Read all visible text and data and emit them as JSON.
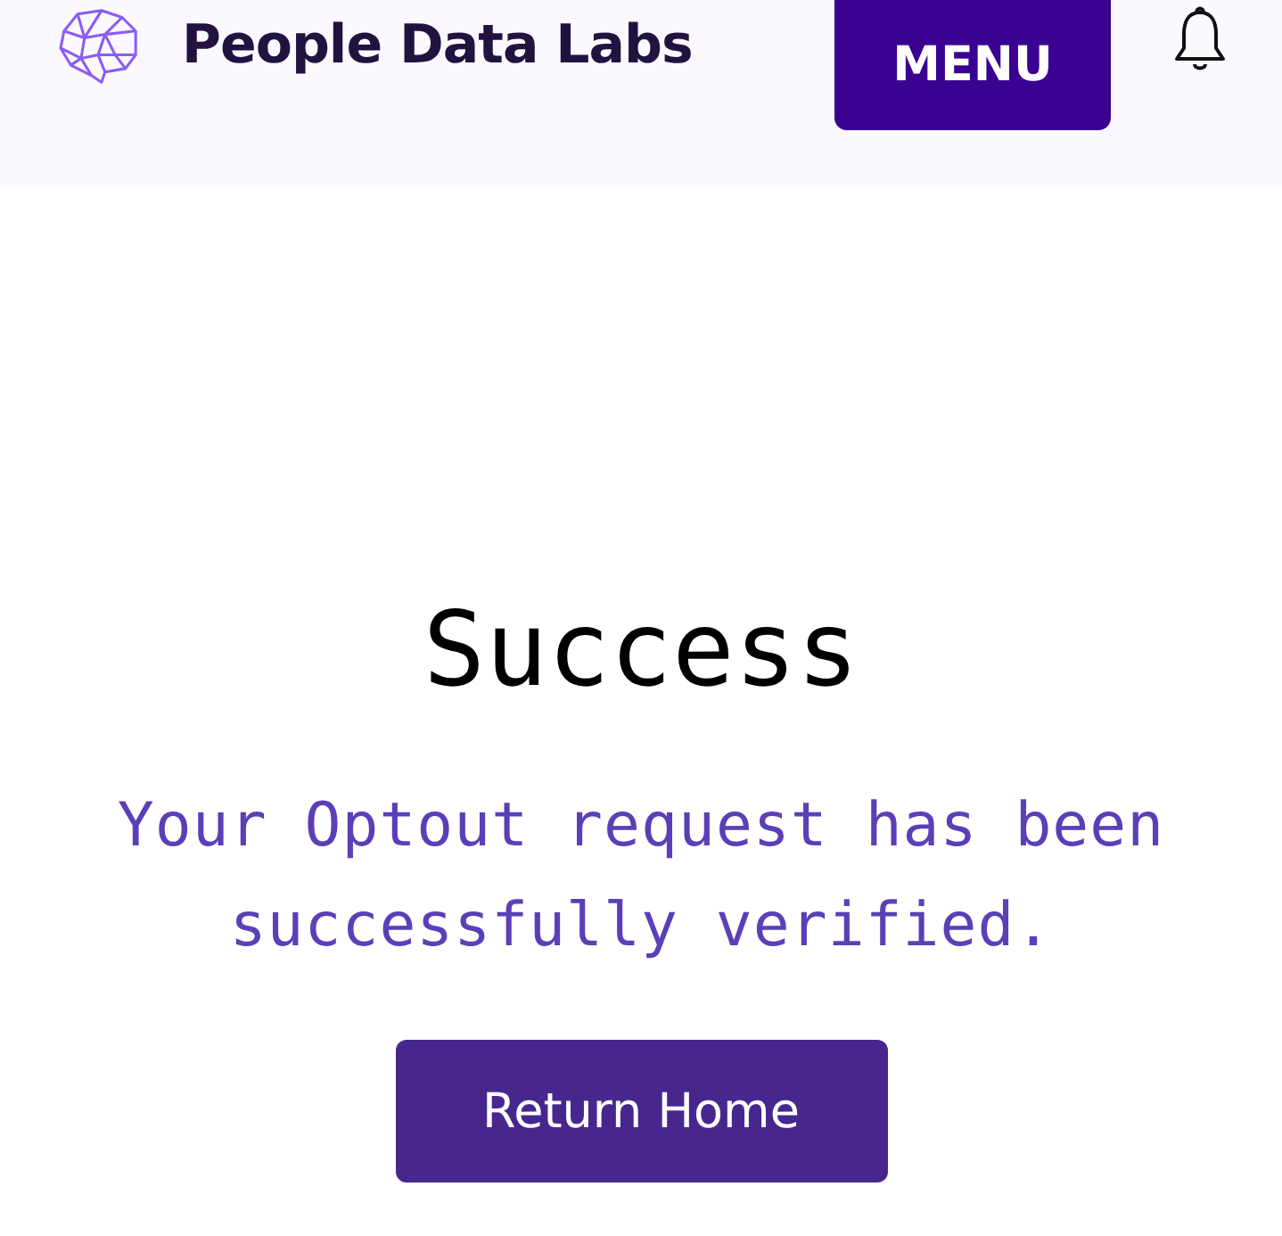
{
  "header": {
    "brand": "People Data Labs",
    "menu_button": "MENU"
  },
  "main": {
    "title": "Success",
    "message": "Your Optout request has been successfully verified.",
    "button": "Return Home"
  }
}
